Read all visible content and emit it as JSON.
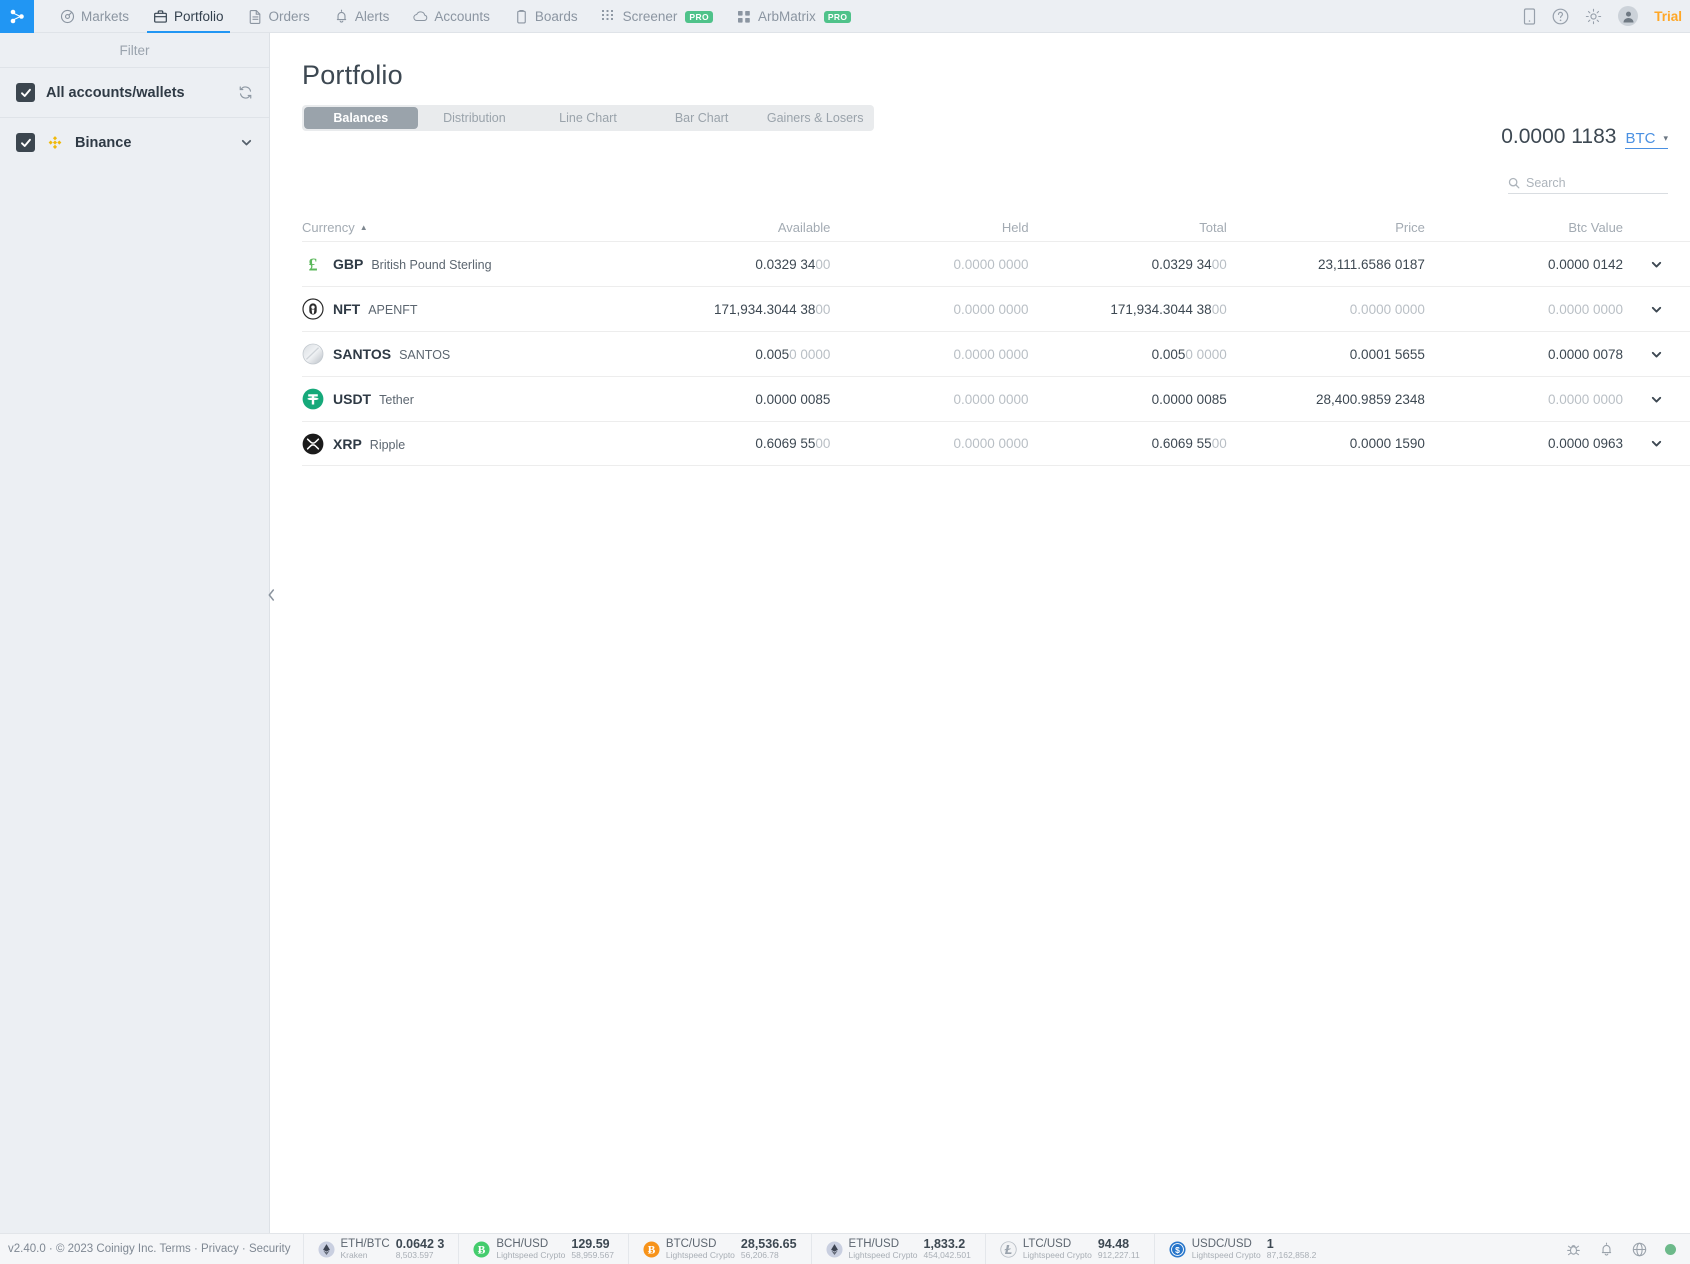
{
  "topnav": {
    "logo": "coinigy-logo-icon",
    "items": [
      {
        "label": "Markets",
        "icon": "markets-icon",
        "active": false,
        "pro": ""
      },
      {
        "label": "Portfolio",
        "icon": "briefcase-icon",
        "active": true,
        "pro": ""
      },
      {
        "label": "Orders",
        "icon": "document-icon",
        "active": false,
        "pro": ""
      },
      {
        "label": "Alerts",
        "icon": "bell-icon",
        "active": false,
        "pro": ""
      },
      {
        "label": "Accounts",
        "icon": "cloud-icon",
        "active": false,
        "pro": ""
      },
      {
        "label": "Boards",
        "icon": "clipboard-icon",
        "active": false,
        "pro": ""
      },
      {
        "label": "Screener",
        "icon": "grid-icon",
        "active": false,
        "pro": "PRO"
      },
      {
        "label": "ArbMatrix",
        "icon": "squares-icon",
        "active": false,
        "pro": "PRO"
      }
    ],
    "right": {
      "mobile_label": "mobile-icon",
      "help_label": "help-icon",
      "settings_label": "gear-icon",
      "avatar_label": "user-avatar",
      "account_status": "Trial"
    }
  },
  "sidebar": {
    "title": "Filter",
    "all_accounts": {
      "label": "All accounts/wallets",
      "checked": true,
      "refresh_icon": "refresh-icon"
    },
    "exchanges": [
      {
        "label": "Binance",
        "checked": true,
        "icon": "binance-icon",
        "chevron": "chevron-down-icon"
      }
    ]
  },
  "main": {
    "page_title": "Portfolio",
    "tabs": [
      {
        "label": "Balances",
        "active": true
      },
      {
        "label": "Distribution",
        "active": false
      },
      {
        "label": "Line Chart",
        "active": false
      },
      {
        "label": "Bar Chart",
        "active": false
      },
      {
        "label": "Gainers & Losers",
        "active": false
      }
    ],
    "balance": {
      "value": "0.0000 1183",
      "currency": "BTC",
      "caret": "▾"
    },
    "search": {
      "placeholder": "Search",
      "value": "",
      "icon": "search-icon"
    },
    "table": {
      "columns": [
        "Currency",
        "Available",
        "Held",
        "Total",
        "Price",
        "Btc Value"
      ],
      "sort_column": "Currency",
      "sort_direction": "asc",
      "sort_arrow": "▲",
      "rows": [
        {
          "icon": "gbp-pound-icon",
          "symbol": "GBP",
          "name": "British Pound Sterling",
          "available": "0.0329 3400",
          "available_dim": "00",
          "held": "0.0000 0000",
          "held_zero": true,
          "total": "0.0329 3400",
          "total_dim": "00",
          "price": "23,111.6586 0187",
          "price_zero": false,
          "btc_value": "0.0000 0142",
          "btc_zero": false,
          "chevron": "chevron-down-icon"
        },
        {
          "icon": "apenft-icon",
          "symbol": "NFT",
          "name": "APENFT",
          "available": "171,934.3044 3800",
          "available_dim": "00",
          "held": "0.0000 0000",
          "held_zero": true,
          "total": "171,934.3044 3800",
          "total_dim": "00",
          "price": "0.0000 0000",
          "price_zero": true,
          "btc_value": "0.0000 0000",
          "btc_zero": true,
          "chevron": "chevron-down-icon"
        },
        {
          "icon": "santos-icon",
          "symbol": "SANTOS",
          "name": "SANTOS",
          "available": "0.0050 0000",
          "available_dim": "0 0000",
          "held": "0.0000 0000",
          "held_zero": true,
          "total": "0.0050 0000",
          "total_dim": "0 0000",
          "price": "0.0001 5655",
          "price_zero": false,
          "btc_value": "0.0000 0078",
          "btc_zero": false,
          "chevron": "chevron-down-icon"
        },
        {
          "icon": "tether-icon",
          "symbol": "USDT",
          "name": "Tether",
          "available": "0.0000 0085",
          "available_dim": "",
          "held": "0.0000 0000",
          "held_zero": true,
          "total": "0.0000 0085",
          "total_dim": "",
          "price": "28,400.9859 2348",
          "price_zero": false,
          "btc_value": "0.0000 0000",
          "btc_zero": true,
          "chevron": "chevron-down-icon"
        },
        {
          "icon": "ripple-icon",
          "symbol": "XRP",
          "name": "Ripple",
          "available": "0.6069 5500",
          "available_dim": "00",
          "held": "0.0000 0000",
          "held_zero": true,
          "total": "0.6069 5500",
          "total_dim": "00",
          "price": "0.0000 1590",
          "price_zero": false,
          "btc_value": "0.0000 0963",
          "btc_zero": false,
          "chevron": "chevron-down-icon"
        }
      ]
    }
  },
  "footer": {
    "version_text": "v2.40.0 · © 2023 Coinigy Inc.",
    "links": [
      "Terms",
      "Privacy",
      "Security"
    ],
    "separator": "·",
    "tickers": [
      {
        "icon": "eth-icon",
        "pair": "ETH/BTC",
        "exchange": "Kraken",
        "price": "0.0642 3",
        "volume": "8,503.597"
      },
      {
        "icon": "bch-icon",
        "pair": "BCH/USD",
        "exchange": "Lightspeed Crypto",
        "price": "129.59",
        "volume": "58,959.567"
      },
      {
        "icon": "btc-icon",
        "pair": "BTC/USD",
        "exchange": "Lightspeed Crypto",
        "price": "28,536.65",
        "volume": "56,206.78"
      },
      {
        "icon": "eth-icon",
        "pair": "ETH/USD",
        "exchange": "Lightspeed Crypto",
        "price": "1,833.2",
        "volume": "454,042.501"
      },
      {
        "icon": "ltc-icon",
        "pair": "LTC/USD",
        "exchange": "Lightspeed Crypto",
        "price": "94.48",
        "volume": "912,227.11"
      },
      {
        "icon": "usdc-icon",
        "pair": "USDC/USD",
        "exchange": "Lightspeed Crypto",
        "price": "1",
        "volume": "87,162,858.2"
      }
    ],
    "right_icons": [
      "bug-icon",
      "bell-icon",
      "globe-icon",
      "status-online-dot"
    ]
  }
}
